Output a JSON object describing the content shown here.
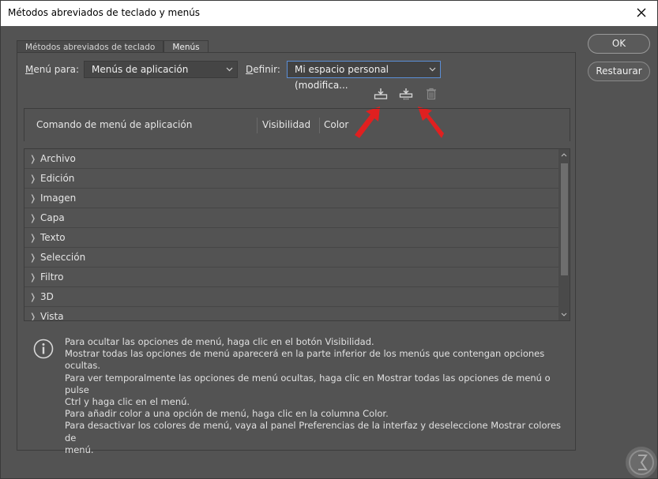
{
  "window": {
    "title": "Métodos abreviados de teclado y menús"
  },
  "tabs": [
    {
      "label": "Métodos abreviados de teclado"
    },
    {
      "label": "Menús"
    }
  ],
  "menu_for": {
    "label_pre": "",
    "label_u": "M",
    "label_post": "enú para:",
    "value": "Menús de aplicación"
  },
  "define": {
    "label_u": "D",
    "label_post": "efinir:",
    "value": "Mi espacio personal (modifica..."
  },
  "table_header": {
    "command": "Comando de menú de aplicación",
    "visibility": "Visibilidad",
    "color": "Color"
  },
  "menu_items": [
    "Archivo",
    "Edición",
    "Imagen",
    "Capa",
    "Texto",
    "Selección",
    "Filtro",
    "3D",
    "Vista"
  ],
  "info_lines": [
    "Para ocultar las opciones de menú, haga clic en el botón Visibilidad.",
    "Mostrar todas las opciones de menú aparecerá en la parte inferior de los menús que contengan opciones ocultas.",
    "Para ver temporalmente las opciones de menú ocultas, haga clic en Mostrar todas las opciones de menú o pulse",
    "Ctrl y haga clic en el menú.",
    "Para añadir color a una opción de menú, haga clic en la columna Color.",
    "Para desactivar los colores de menú, vaya al panel Preferencias de la interfaz y deseleccione Mostrar colores de",
    "menú."
  ],
  "buttons": {
    "ok": "OK",
    "reset": "Restaurar"
  },
  "colors": {
    "background": "#535353",
    "arrow_annotation": "#e02020",
    "focus": "#5b8ed6"
  },
  "icons": [
    "save-set-icon",
    "save-set-as-icon",
    "delete-set-icon",
    "info-icon",
    "close-icon"
  ]
}
